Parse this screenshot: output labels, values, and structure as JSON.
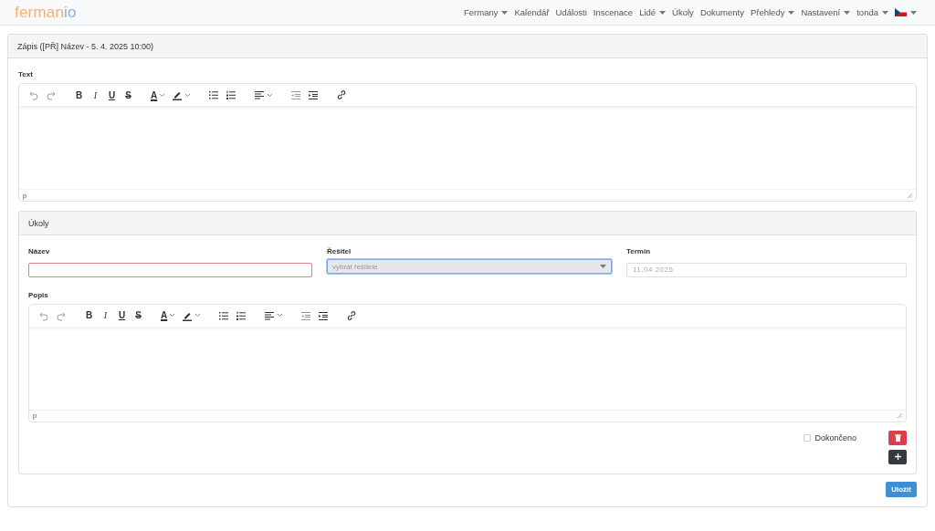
{
  "navbar": {
    "logo_main": "ferman",
    "logo_accent": "io",
    "items": [
      {
        "label": "Fermany",
        "dropdown": true
      },
      {
        "label": "Kalendář",
        "dropdown": false
      },
      {
        "label": "Události",
        "dropdown": false
      },
      {
        "label": "Inscenace",
        "dropdown": false
      },
      {
        "label": "Lidé",
        "dropdown": true
      },
      {
        "label": "Úkoly",
        "dropdown": false
      },
      {
        "label": "Dokumenty",
        "dropdown": false
      },
      {
        "label": "Přehledy",
        "dropdown": true
      },
      {
        "label": "Nastavení",
        "dropdown": true
      },
      {
        "label": "tonda",
        "dropdown": true
      }
    ],
    "language": {
      "kind": "flag",
      "dropdown": true
    }
  },
  "card": {
    "title": "Zápis ([PŘ] Název - 5. 4. 2025 10:00)",
    "text_editor": {
      "label": "Text",
      "status": "p",
      "toolbar": [
        [
          {
            "kind": "undo"
          },
          {
            "kind": "redo"
          }
        ],
        [
          {
            "kind": "bold",
            "label": "B"
          },
          {
            "kind": "italic",
            "label": "I"
          },
          {
            "kind": "underline",
            "label": "U"
          },
          {
            "kind": "strike",
            "label": "S"
          }
        ],
        [
          {
            "kind": "textcolor",
            "label": "A",
            "dropdown": true
          },
          {
            "kind": "highlight",
            "dropdown": true
          }
        ],
        [
          {
            "kind": "bullist"
          },
          {
            "kind": "numlist"
          }
        ],
        [
          {
            "kind": "align",
            "dropdown": true
          }
        ],
        [
          {
            "kind": "outdent"
          },
          {
            "kind": "indent"
          }
        ],
        [
          {
            "kind": "link"
          }
        ]
      ]
    },
    "tasks": {
      "title": "Úkoly",
      "fields": [
        {
          "kind": "text",
          "label": "Název",
          "invalid": true
        },
        {
          "kind": "select",
          "label": "Řešitel",
          "placeholder": "vybrat řešitele",
          "focused": true
        },
        {
          "kind": "date",
          "label": "Termín",
          "placeholder": "11.04.2025"
        }
      ],
      "description_editor": {
        "label": "Popis",
        "status": "p",
        "toolbar": [
          [
            {
              "kind": "undo"
            },
            {
              "kind": "redo"
            }
          ],
          [
            {
              "kind": "bold",
              "label": "B"
            },
            {
              "kind": "italic",
              "label": "I"
            },
            {
              "kind": "underline",
              "label": "U"
            },
            {
              "kind": "strike",
              "label": "S"
            }
          ],
          [
            {
              "kind": "textcolor",
              "label": "A",
              "dropdown": true
            },
            {
              "kind": "highlight",
              "dropdown": true
            }
          ],
          [
            {
              "kind": "bullist"
            },
            {
              "kind": "numlist"
            }
          ],
          [
            {
              "kind": "align",
              "dropdown": true
            }
          ],
          [
            {
              "kind": "outdent"
            },
            {
              "kind": "indent"
            }
          ],
          [
            {
              "kind": "link"
            }
          ]
        ]
      },
      "done": {
        "label": "Dokončeno",
        "checked": false
      }
    },
    "save_button": "Uložit"
  }
}
